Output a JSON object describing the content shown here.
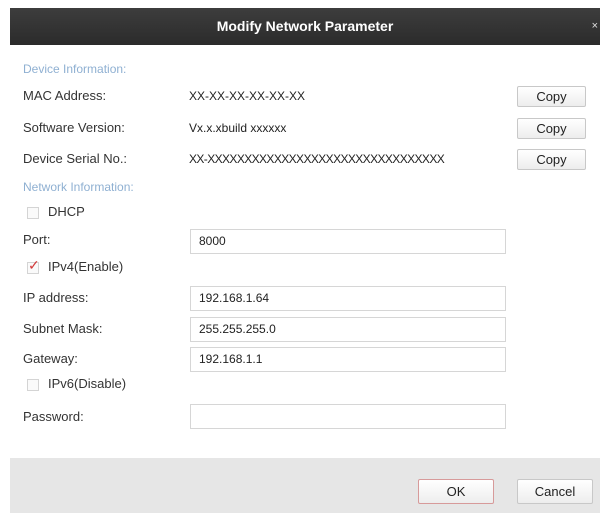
{
  "dialog": {
    "title": "Modify Network Parameter",
    "close_glyph": "×"
  },
  "device_info": {
    "heading": "Device Information:",
    "mac_label": "MAC Address:",
    "mac_value": "XX-XX-XX-XX-XX-XX",
    "sw_label": "Software Version:",
    "sw_value": "Vx.x.xbuild xxxxxx",
    "serial_label": "Device Serial No.:",
    "serial_value": "XX-XXXXXXXXXXXXXXXXXXXXXXXXXXXXXXXX",
    "copy_label": "Copy"
  },
  "network_info": {
    "heading": "Network Information:",
    "dhcp_label": "DHCP",
    "dhcp_checked": false,
    "port_label": "Port:",
    "port_value": "8000",
    "ipv4_label": "IPv4(Enable)",
    "ipv4_checked": true,
    "check_glyph": "✓",
    "ip_label": "IP address:",
    "ip_value": "192.168.1.64",
    "subnet_label": "Subnet Mask:",
    "subnet_value": "255.255.255.0",
    "gateway_label": "Gateway:",
    "gateway_value": "192.168.1.1",
    "ipv6_label": "IPv6(Disable)",
    "ipv6_checked": false,
    "password_label": "Password:",
    "password_value": ""
  },
  "footer": {
    "ok_label": "OK",
    "cancel_label": "Cancel"
  },
  "colors": {
    "accent": "#d23a3a",
    "section_heading": "#8fb0d2",
    "titlebar": "#333333",
    "footer": "#e6e6e6"
  }
}
